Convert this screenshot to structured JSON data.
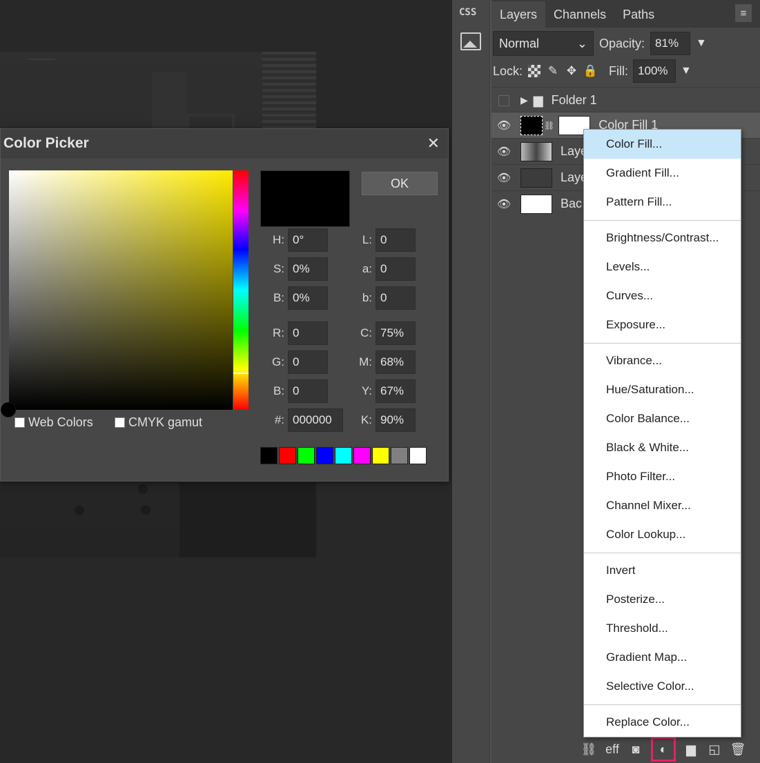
{
  "color_picker": {
    "title": "Color Picker",
    "ok_label": "OK",
    "web_colors_label": "Web Colors",
    "cmyk_gamut_label": "CMYK gamut",
    "fields": {
      "h": {
        "label": "H:",
        "value": "0°"
      },
      "s": {
        "label": "S:",
        "value": "0%"
      },
      "b": {
        "label": "B:",
        "value": "0%"
      },
      "l": {
        "label": "L:",
        "value": "0"
      },
      "a": {
        "label": "a:",
        "value": "0"
      },
      "b_lab": {
        "label": "b:",
        "value": "0"
      },
      "r": {
        "label": "R:",
        "value": "0"
      },
      "g": {
        "label": "G:",
        "value": "0"
      },
      "b_rgb": {
        "label": "B:",
        "value": "0"
      },
      "c": {
        "label": "C:",
        "value": "75%"
      },
      "m": {
        "label": "M:",
        "value": "68%"
      },
      "y": {
        "label": "Y:",
        "value": "67%"
      },
      "k": {
        "label": "K:",
        "value": "90%"
      },
      "hex": {
        "label": "#:",
        "value": "000000"
      }
    },
    "swatches": [
      "#000000",
      "#ff0000",
      "#00ff00",
      "#0000ff",
      "#00ffff",
      "#ff00ff",
      "#ffff00",
      "#808080",
      "#ffffff"
    ]
  },
  "left_tools": {
    "css_label": "CSS"
  },
  "layers_panel": {
    "tabs": [
      {
        "label": "Layers",
        "active": true
      },
      {
        "label": "Channels",
        "active": false
      },
      {
        "label": "Paths",
        "active": false
      }
    ],
    "blend_mode": "Normal",
    "opacity_label": "Opacity:",
    "opacity_value": "81%",
    "lock_label": "Lock:",
    "fill_label": "Fill:",
    "fill_value": "100%",
    "layers": [
      {
        "name": "Folder 1",
        "type": "folder"
      },
      {
        "name": "Color Fill 1",
        "type": "fill"
      },
      {
        "name": "Laye",
        "type": "image"
      },
      {
        "name": "Laye",
        "type": "layer"
      },
      {
        "name": "Bac",
        "type": "background"
      }
    ]
  },
  "context_menu": {
    "groups": [
      [
        "Color Fill...",
        "Gradient Fill...",
        "Pattern Fill..."
      ],
      [
        "Brightness/Contrast...",
        "Levels...",
        "Curves...",
        "Exposure..."
      ],
      [
        "Vibrance...",
        "Hue/Saturation...",
        "Color Balance...",
        "Black & White...",
        "Photo Filter...",
        "Channel Mixer...",
        "Color Lookup..."
      ],
      [
        "Invert",
        "Posterize...",
        "Threshold...",
        "Gradient Map...",
        "Selective Color..."
      ],
      [
        "Replace Color..."
      ]
    ],
    "hovered": "Color Fill..."
  },
  "bottom_bar": {
    "effects_label": "eff"
  }
}
